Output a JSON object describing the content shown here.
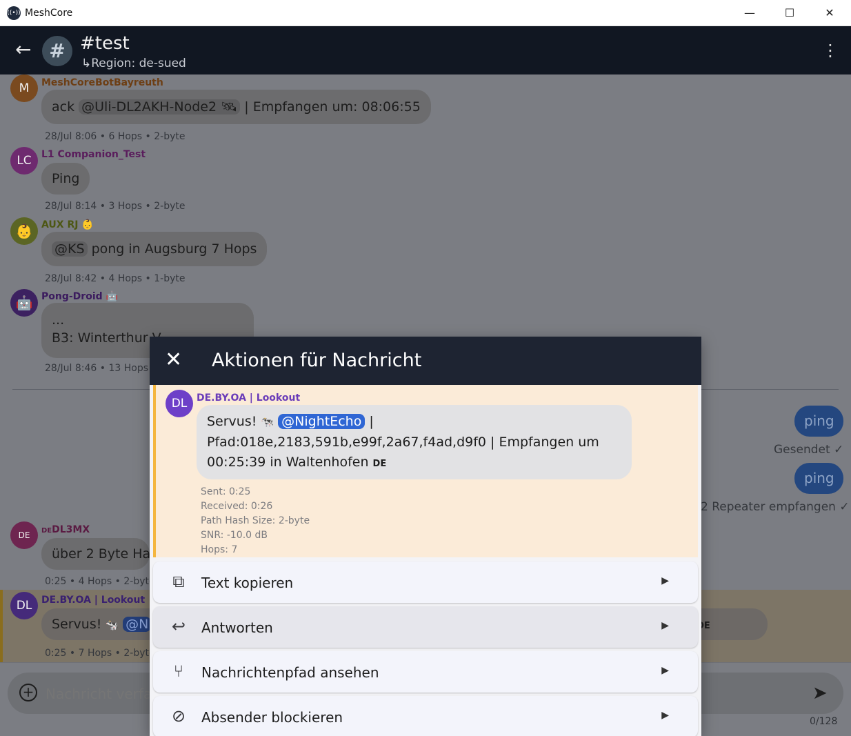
{
  "window": {
    "title": "MeshCore",
    "minimize_glyph": "—",
    "maximize_glyph": "☐",
    "close_glyph": "✕"
  },
  "appbar": {
    "channel_title": "#test",
    "channel_icon": "#",
    "region": "↳Region: de-sued",
    "back_glyph": "←",
    "more_glyph": "⋮"
  },
  "messages": [
    {
      "avatar": "M",
      "avatar_color": "#b16216",
      "sender": "MeshCoreBotBayreuth",
      "sender_color": "#8a4d14",
      "text_prefix": "ack",
      "mention": "@Uli-DL2AKH-Node2",
      "emoji": "🛰",
      "text_suffix": "| Empfangen um: 08:06:55",
      "meta": "28/Jul 8:06 • 6 Hops • 2-byte"
    },
    {
      "avatar": "LC",
      "avatar_color": "#8c2a8d",
      "sender": "L1 Companion_Test",
      "sender_color": "#6e2070",
      "text": "Ping",
      "meta": "28/Jul 8:14 • 3 Hops • 2-byte"
    },
    {
      "avatar": "👶",
      "avatar_color": "#6b7b1f",
      "sender": "AUX RJ",
      "sender_emoji": "👶",
      "sender_color": "#5d6d15",
      "mention": "@KS",
      "text_suffix": "pong in Augsburg 7 Hops",
      "meta": "28/Jul 8:42 • 4 Hops • 1-byte"
    },
    {
      "avatar": "🤖",
      "avatar_color": "#4d2378",
      "sender": "Pong-Droid",
      "sender_emoji": "🤖",
      "sender_color": "#45206b",
      "line1": "...",
      "line2": "B3: Winterthur V",
      "meta": "28/Jul 8:46 • 13 Hops"
    },
    {
      "avatar": "DE",
      "avatar_color": "#8c2c61",
      "sender_prefix": "DE",
      "sender": "DL3MX",
      "sender_color": "#6b1f4b",
      "text": "über 2 Byte Ha",
      "meta": "0:25 • 4 Hops • 2-byte"
    },
    {
      "avatar": "DL",
      "avatar_color": "#4a2a8a",
      "sender": "DE.BY.OA | Lookout",
      "sender_color": "#3f2478",
      "text_prefix": "Servus!",
      "emoji": "🐄",
      "mention": "@N",
      "trail": "hofen",
      "trail_caps": "DE",
      "meta": "0:25 • 7 Hops • 2-byte"
    }
  ],
  "outgoing": [
    {
      "text": "ping",
      "status": "Gesendet",
      "status_icon": "✓"
    },
    {
      "text": "ping",
      "status": "2 Repeater empfangen",
      "status_icon": "✓"
    }
  ],
  "composer": {
    "add_glyph": "+",
    "placeholder": "Nachricht verfassen",
    "send_glyph": "➤",
    "counter": "0/128"
  },
  "dialog": {
    "title": "Aktionen für Nachricht",
    "close_glyph": "✕",
    "preview": {
      "avatar": "DL",
      "sender": "DE.BY.OA | Lookout",
      "text_prefix": "Servus!",
      "emoji": "🐄",
      "mention": "@NightEcho",
      "text_line1_suffix": "|",
      "text_line2": "Pfad:018e,2183,591b,e99f,2a67,f4ad,d9f0 | Empfangen um",
      "text_line3": "00:25:39 in Waltenhofen",
      "text_line3_caps": "DE",
      "details": [
        "Sent: 0:25",
        "Received: 0:26",
        "Path Hash Size: 2-byte",
        "SNR: -10.0 dB",
        "Hops: 7"
      ]
    },
    "actions": [
      {
        "label": "Text kopieren",
        "icon": "copy-icon",
        "glyph": "⧉"
      },
      {
        "label": "Antworten",
        "icon": "reply-icon",
        "glyph": "↩"
      },
      {
        "label": "Nachrichtenpfad ansehen",
        "icon": "route-icon",
        "glyph": "⑂"
      },
      {
        "label": "Absender blockieren",
        "icon": "block-icon",
        "glyph": "⊘"
      }
    ],
    "arrow_glyph": "▶"
  }
}
